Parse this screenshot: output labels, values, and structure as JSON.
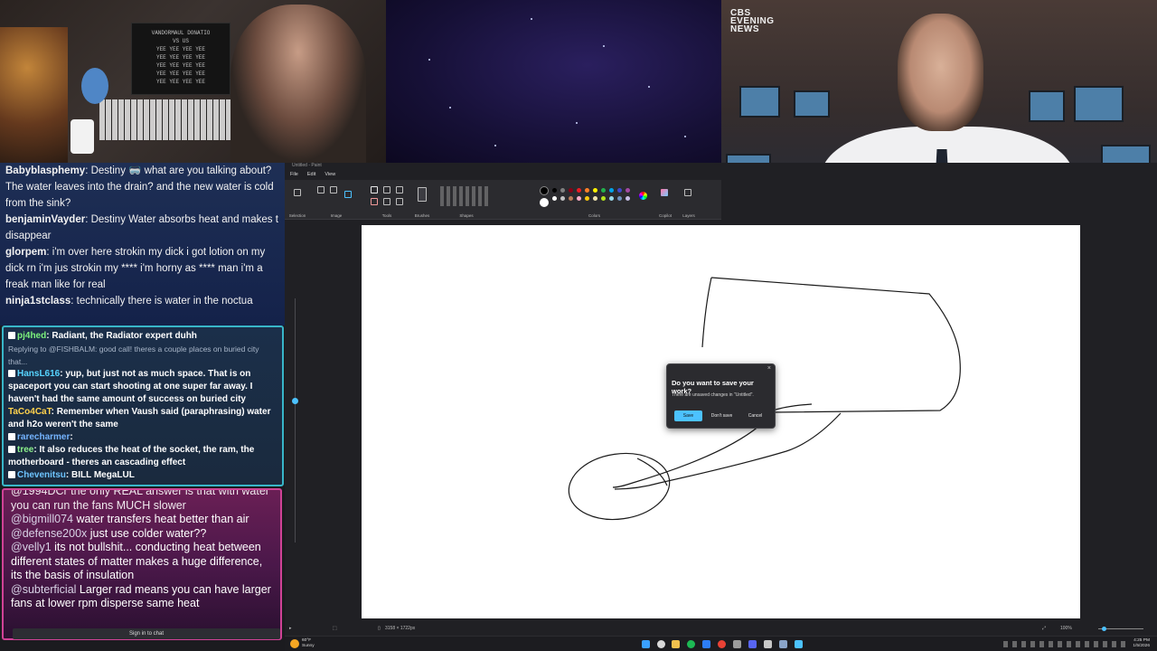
{
  "webcam": {
    "sign_lines": [
      "VANDORMAUL DONATIO",
      "VS US",
      "YEE YEE YEE YEE",
      "YEE YEE YEE YEE",
      "YEE YEE YEE YEE",
      "YEE YEE YEE YEE",
      "YEE YEE YEE YEE"
    ]
  },
  "news": {
    "logo_lines": [
      "CBS",
      "EVENING",
      "NEWS"
    ]
  },
  "chat_top": {
    "messages": [
      {
        "user": "Babyblasphemy",
        "text": ": Destiny 🥽 what are you talking about? The water leaves into the drain? and the new water is cold from the sink?"
      },
      {
        "user": "benjaminVayder",
        "text": ": Destiny Water absorbs heat and makes t disappear"
      },
      {
        "user": "glorpem",
        "text": ": i'm over here strokin my dick i got lotion on my dick rn i'm jus strokin my **** i'm horny as **** man i'm a freak man like for real"
      },
      {
        "user": "ninja1stclass",
        "text": ": technically there is water in the noctua"
      }
    ]
  },
  "chat_mid": {
    "messages": [
      {
        "user": "pj4hed",
        "text": ": Radiant, the Radiator expert duhh"
      },
      {
        "reply": "Replying to @FISHBALM: good call! theres a couple places on buried city that..."
      },
      {
        "user": "HansL616",
        "text": ": yup, but just not as much space. That is on spaceport you can start shooting at one super far away. I haven't had the same amount of success on buried city"
      },
      {
        "user": "TaCo4CaT",
        "text": ": Remember when Vaush said (paraphrasing) water and h2o weren't the same"
      },
      {
        "user": "rarecharmer",
        "text": ":"
      },
      {
        "user": "tree",
        "text": ": It also reduces the heat of the socket, the ram, the motherboard - theres an cascading effect"
      },
      {
        "user": "Chevenitsu",
        "text": ": BILL MegaLUL"
      }
    ]
  },
  "chat_bot": {
    "partial_top": "@1994DCr the only REAL answer is that with water you can run the fans MUCH slower",
    "messages": [
      {
        "user": "@bigmill074",
        "text": " water transfers heat better than air"
      },
      {
        "user": "@defense200x",
        "text": " just use colder water??"
      },
      {
        "user": "@velly1",
        "text": " its not bullshit... conducting heat between different states of matter makes a huge difference, its the basis of insulation"
      },
      {
        "user": "@subterficial",
        "text": " Larger rad means you can have larger fans at lower rpm disperse same heat"
      }
    ],
    "signin_label": "Sign in to chat"
  },
  "paint": {
    "title": "Untitled - Paint",
    "menu": [
      "File",
      "Edit",
      "View"
    ],
    "ribbon_groups": [
      "Selection",
      "Image",
      "Tools",
      "Brushes",
      "Shapes",
      "Colors",
      "Copilot",
      "Layers"
    ],
    "status_size": "3158 × 1722px",
    "zoom": "100%",
    "palette": [
      "#000000",
      "#7f7f7f",
      "#880015",
      "#ed1c24",
      "#ff7f27",
      "#fff200",
      "#22b14c",
      "#00a2e8",
      "#3f48cc",
      "#a349a4",
      "#ffffff",
      "#c3c3c3",
      "#b97a57",
      "#ffaec9",
      "#ffc90e",
      "#efe4b0",
      "#b5e61d",
      "#99d9ea",
      "#7092be",
      "#c8bfe7"
    ]
  },
  "dialog": {
    "title": "Do you want to save your work?",
    "message": "There are unsaved changes in \"Untitled\".",
    "save": "Save",
    "dont_save": "Don't save",
    "cancel": "Cancel",
    "close": "×"
  },
  "taskbar": {
    "weather_temp": "60°F",
    "weather_desc": "Sunny",
    "time": "4:25 PM",
    "date": "1/5/2026"
  }
}
